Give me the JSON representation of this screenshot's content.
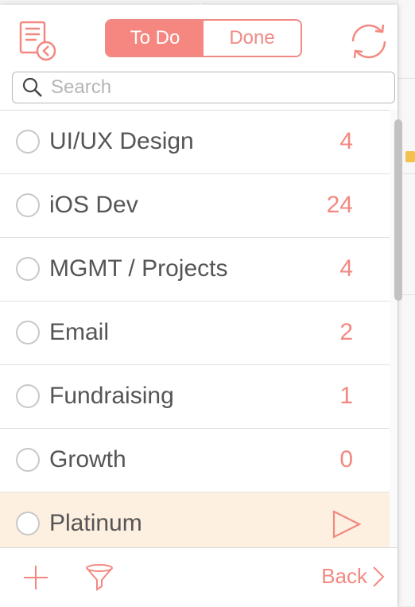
{
  "toolbar": {
    "tab_todo": "To Do",
    "tab_done": "Done",
    "selected_tab": "To Do",
    "notes_icon": "notes-back-icon",
    "sync_icon": "sync-icon"
  },
  "search": {
    "placeholder": "Search",
    "value": ""
  },
  "lists": [
    {
      "label": "UI/UX Design",
      "count": "4"
    },
    {
      "label": "iOS Dev",
      "count": "24"
    },
    {
      "label": "MGMT / Projects",
      "count": "4"
    },
    {
      "label": "Email",
      "count": "2"
    },
    {
      "label": "Fundraising",
      "count": "1"
    },
    {
      "label": "Growth",
      "count": "0"
    },
    {
      "label": "Platinum",
      "count": ""
    }
  ],
  "bottom": {
    "back_label": "Back",
    "add_icon": "plus-icon",
    "filter_icon": "filter-icon"
  },
  "colors": {
    "accent": "#f38880",
    "active_row": "#fdf0e0"
  }
}
